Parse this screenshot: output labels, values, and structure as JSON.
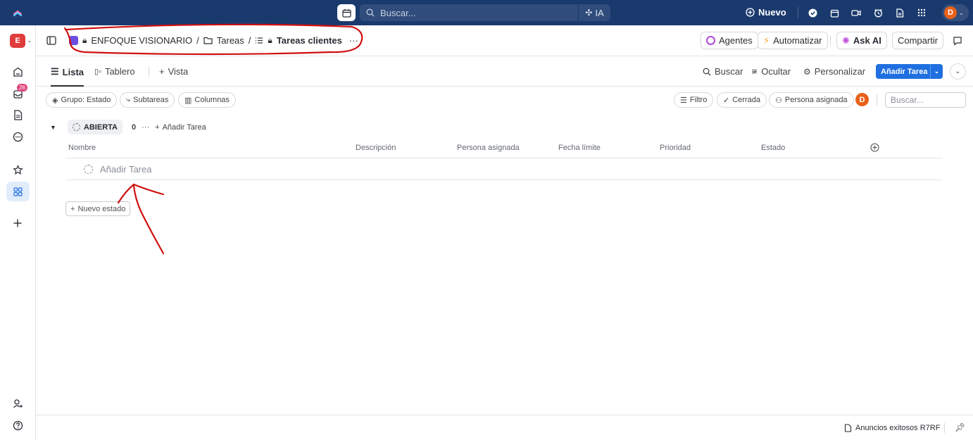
{
  "topbar": {
    "search_placeholder": "Buscar...",
    "ai_label": "IA",
    "new_label": "Nuevo"
  },
  "sidebar": {
    "workspace_initial": "E",
    "inbox_badge": "26"
  },
  "header": {
    "crumbs": {
      "space": "ENFOQUE VISIONARIO",
      "sep": "/",
      "folder": "Tareas",
      "list": "Tareas clientes",
      "more": "···"
    },
    "buttons": {
      "agents": "Agentes",
      "automate": "Automatizar",
      "ask_ai": "Ask AI",
      "share": "Compartir"
    }
  },
  "views": {
    "list": "Lista",
    "board": "Tablero",
    "add_view": "Vista",
    "search": "Buscar",
    "hide": "Ocultar",
    "customize": "Personalizar",
    "add_task": "Añadir Tarea"
  },
  "filters": {
    "group": "Grupo: Estado",
    "subtasks": "Subtareas",
    "columns": "Columnas",
    "filter": "Filtro",
    "closed": "Cerrada",
    "assignee": "Persona asignada",
    "avatar_initial": "D",
    "search_placeholder": "Buscar..."
  },
  "group": {
    "status": "ABIERTA",
    "count": "0",
    "add_task": "Añadir Tarea"
  },
  "table": {
    "columns": [
      "Nombre",
      "Descripción",
      "Persona asignada",
      "Fecha límite",
      "Prioridad",
      "Estado"
    ],
    "add_task_row": "Añadir Tarea",
    "new_status": "Nuevo estado"
  },
  "footer": {
    "doc_label": "Anuncios exitosos R7RF"
  },
  "colors": {
    "topbar": "#1a3a6e",
    "accent": "#1f6fe0",
    "annotation": "#d01010"
  }
}
